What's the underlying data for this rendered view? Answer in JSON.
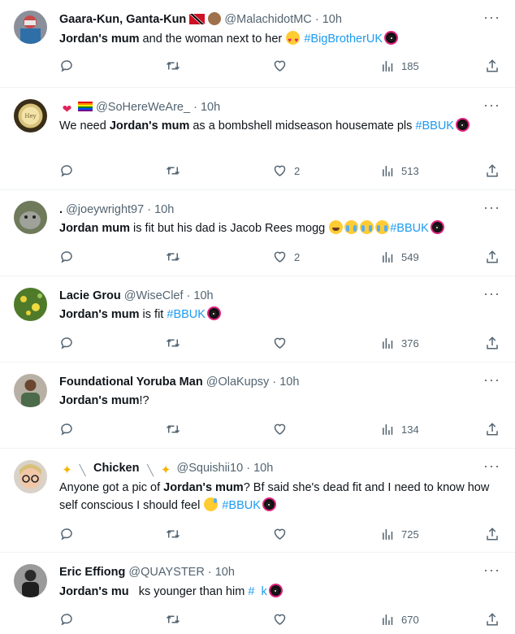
{
  "tweets": [
    {
      "display_name": "Gaara-Kun, Ganta-Kun",
      "handle": "@MalachidotMC",
      "time": "10h",
      "text_before": "",
      "bold": "Jordan's mum",
      "text_after": " and the woman next to her",
      "hashtag": "#BigBrotherUK",
      "likes": "",
      "views": "185"
    },
    {
      "display_name": "",
      "handle": "@SoHereWeAre_",
      "time": "10h",
      "text_before": "We need ",
      "bold": "Jordan's mum",
      "text_after": " as a bombshell midseason housemate pls",
      "hashtag": "#BBUK",
      "likes": "2",
      "views": "513"
    },
    {
      "display_name": ".",
      "handle": "@joeywright97",
      "time": "10h",
      "text_before": "",
      "bold": "Jordan mum",
      "text_after": " is fit but his dad is Jacob Rees mogg",
      "hashtag": "#BBUK",
      "likes": "2",
      "views": "549"
    },
    {
      "display_name": "Lacie Grou",
      "handle": "@WiseClef",
      "time": "10h",
      "text_before": "",
      "bold": "Jordan's mum",
      "text_after": " is fit ",
      "hashtag": "#BBUK",
      "likes": "",
      "views": "376"
    },
    {
      "display_name": "Foundational Yoruba Man",
      "handle": "@OlaKupsy",
      "time": "10h",
      "text_before": "",
      "bold": "Jordan's mum",
      "text_after": "!?",
      "hashtag": "",
      "likes": "",
      "views": "134"
    },
    {
      "display_name": "Chicken",
      "handle": "@Squishii10",
      "time": "10h",
      "text_before": "Anyone got a pic of ",
      "bold": "Jordan's mum",
      "text_after": "? Bf said she's dead fit and I need to know how self conscious I should feel",
      "hashtag": "#BBUK",
      "likes": "",
      "views": "725"
    },
    {
      "display_name": "Eric Effiong",
      "handle": "@QUAYSTER",
      "time": "10h",
      "text_before": "",
      "bold": "Jordan's mu",
      "text_after": "   ks younger than him",
      "hashtag": "#  k",
      "likes": "",
      "views": "670"
    }
  ],
  "colors": {
    "text": "#0f1419",
    "secondary": "#536471",
    "link": "#1d9bf0",
    "divider": "#eff3f4",
    "bb_eye": "#e0217d"
  },
  "icons": [
    "reply-icon",
    "retweet-icon",
    "like-icon",
    "views-icon",
    "share-icon",
    "more-icon",
    "bb-eye-icon"
  ]
}
